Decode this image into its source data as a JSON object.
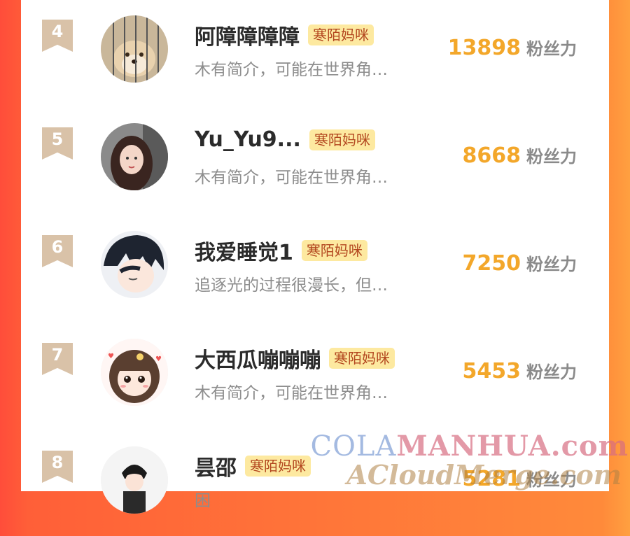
{
  "rows": [
    {
      "rank": "4",
      "name": "阿障障障障",
      "tag": "寒陌妈咪",
      "bio": "木有简介，可能在世界角…",
      "fans": "13898",
      "fans_unit": "粉丝力",
      "avatar_icon": "shiba-dog-avatar"
    },
    {
      "rank": "5",
      "name": "Yu_Yu9...",
      "tag": "寒陌妈咪",
      "bio": "木有简介，可能在世界角…",
      "fans": "8668",
      "fans_unit": "粉丝力",
      "avatar_icon": "girl-photo-avatar"
    },
    {
      "rank": "6",
      "name": "我爱睡觉1",
      "tag": "寒陌妈咪",
      "bio": "追逐光的过程很漫长，但…",
      "fans": "7250",
      "fans_unit": "粉丝力",
      "avatar_icon": "anime-boy-avatar"
    },
    {
      "rank": "7",
      "name": "大西瓜嘣嘣嘣",
      "tag": "寒陌妈咪",
      "bio": "木有简介，可能在世界角…",
      "fans": "5453",
      "fans_unit": "粉丝力",
      "avatar_icon": "chibi-girl-avatar"
    },
    {
      "rank": "8",
      "name": "昙邵",
      "tag": "寒陌妈咪",
      "bio": "困",
      "fans": "5281",
      "fans_unit": "粉丝力",
      "avatar_icon": "anime-figure-avatar"
    }
  ],
  "watermark": {
    "line1_a": "COLA",
    "line1_b": "MANHUA.com",
    "line2": "ACloudMerge.com"
  },
  "colors": {
    "accent_number": "#f3a72a",
    "tag_bg": "#fde9a0",
    "tag_text": "#b3471f",
    "rank_badge": "#d9c2a8"
  }
}
